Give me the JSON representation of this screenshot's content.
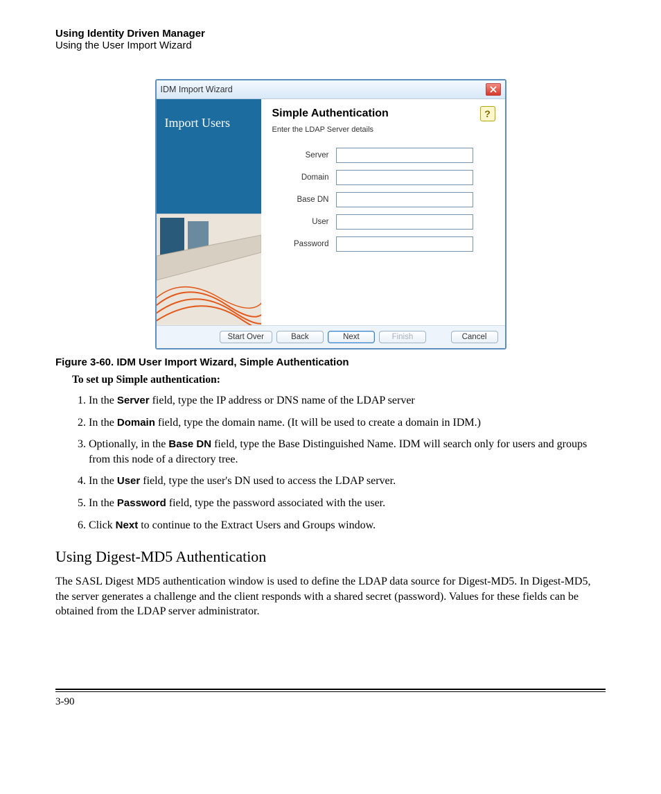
{
  "header": {
    "title": "Using Identity Driven Manager",
    "subtitle": "Using the User Import Wizard"
  },
  "dialog": {
    "title": "IDM Import Wizard",
    "side_title": "Import Users",
    "panel_title": "Simple Authentication",
    "panel_sub": "Enter the LDAP Server details",
    "help": "?",
    "fields": {
      "server": "Server",
      "domain": "Domain",
      "basedn": "Base DN",
      "user": "User",
      "password": "Password"
    },
    "buttons": {
      "startover": "Start Over",
      "back": "Back",
      "next": "Next",
      "finish": "Finish",
      "cancel": "Cancel"
    }
  },
  "caption": "Figure 3-60. IDM User Import Wizard, Simple Authentication",
  "lead": "To set up Simple authentication:",
  "steps": {
    "s1a": "In the ",
    "s1b": "Server",
    "s1c": " field, type the IP address or DNS name of the LDAP server",
    "s2a": "In the ",
    "s2b": "Domain",
    "s2c": " field, type the domain name. (It will be used to create a domain in IDM.)",
    "s3a": "Optionally, in the ",
    "s3b": "Base DN",
    "s3c": " field, type the Base Distinguished Name. IDM will search only for users and groups from this node of a directory tree.",
    "s4a": "In the ",
    "s4b": "User",
    "s4c": " field, type the user's DN used to access the LDAP server.",
    "s5a": "In the ",
    "s5b": "Password",
    "s5c": " field, type the password associated with the user.",
    "s6a": "Click ",
    "s6b": "Next",
    "s6c": " to continue to the Extract Users and Groups window."
  },
  "section_heading": "Using Digest-MD5 Authentication",
  "section_body": "The SASL Digest MD5 authentication window is used to define the LDAP data source for Digest-MD5. In Digest-MD5, the server generates a challenge and the client responds with a shared secret (password). Values for these fields can be obtained from the LDAP server administrator.",
  "page_number": "3-90"
}
